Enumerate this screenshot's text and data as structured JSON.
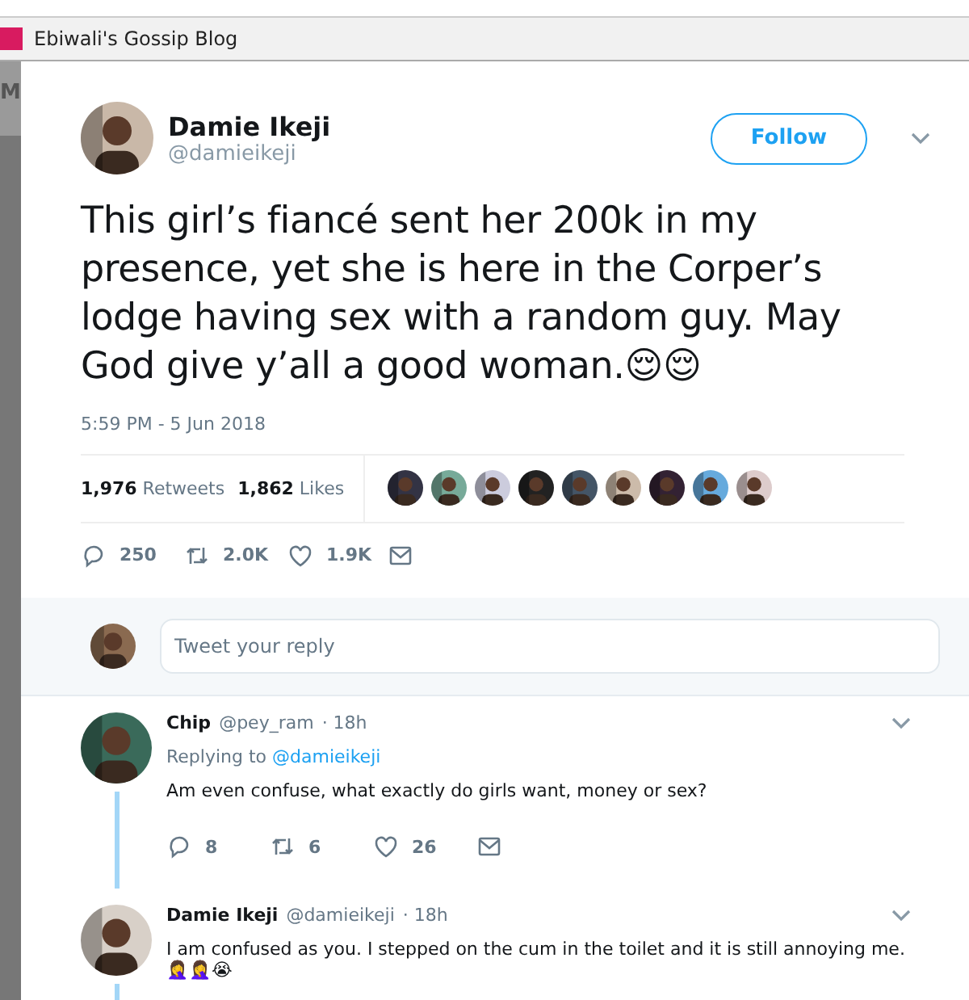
{
  "browser_tab": {
    "title": "Ebiwali's Gossip Blog"
  },
  "side_strip": {
    "label": "M"
  },
  "tweet": {
    "name": "Damie Ikeji",
    "handle": "@damieikeji",
    "follow_label": "Follow",
    "text": "This girl’s fiancé sent her 200k in my presence, yet she is here in the Corper’s lodge having sex with a random guy. May God give y’all a good woman.😌😌",
    "time": "5:59 PM - 5 Jun 2018",
    "retweets_count": "1,976",
    "retweets_label": "Retweets",
    "likes_count": "1,862",
    "likes_label": "Likes",
    "actions": {
      "replies": "250",
      "retweets": "2.0K",
      "likes": "1.9K"
    }
  },
  "reply_box": {
    "placeholder": "Tweet your reply"
  },
  "replies": [
    {
      "name": "Chip",
      "handle": "@pey_ram",
      "time": "· 18h",
      "replying_label": "Replying to",
      "replying_to": "@damieikeji",
      "text": "Am even confuse, what exactly do girls want, money or sex?",
      "thread_line": true,
      "actions": {
        "replies": "8",
        "retweets": "6",
        "likes": "26"
      }
    },
    {
      "name": "Damie Ikeji",
      "handle": "@damieikeji",
      "time": "· 18h",
      "text": "I am confused as you. I stepped on the cum in the toilet and it is still annoying me. 🤦‍♀️🤦‍♀️😭",
      "thread_line": true
    }
  ]
}
